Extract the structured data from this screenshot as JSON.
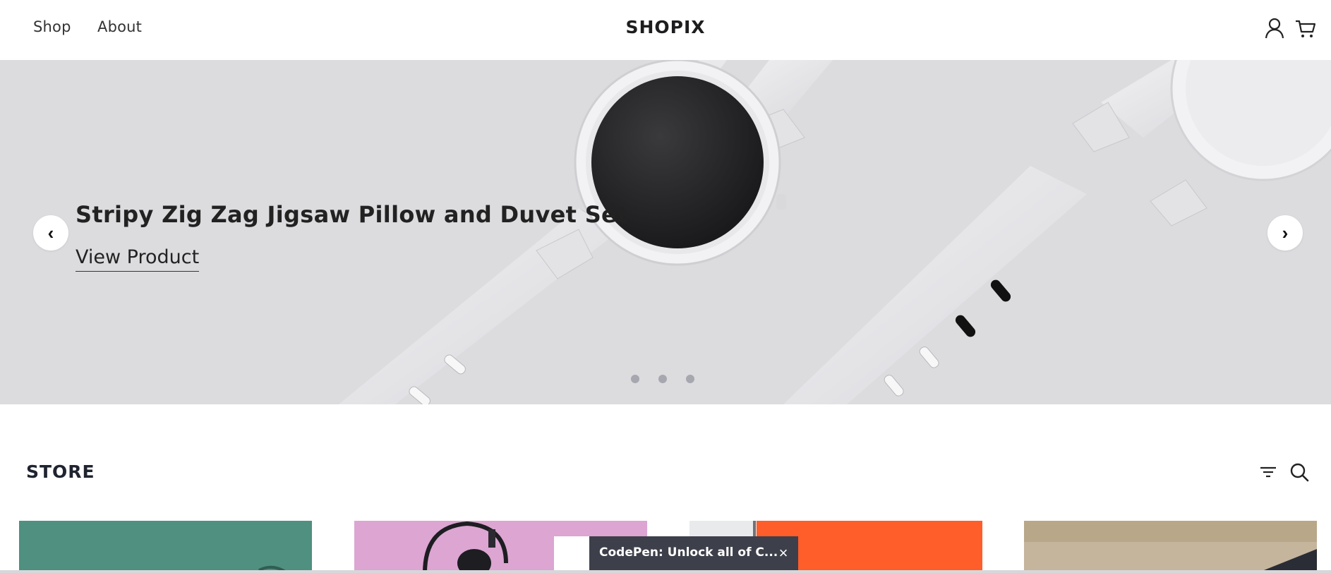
{
  "header": {
    "nav": [
      "Shop",
      "About"
    ],
    "brand": "SHOPIX",
    "icons": [
      "user-icon",
      "cart-icon"
    ]
  },
  "hero": {
    "title": "Stripy Zig Zag Jigsaw Pillow and Duvet Set",
    "cta": "View Product",
    "prev_glyph": "‹",
    "next_glyph": "›",
    "slide_count": 3,
    "image": "white smartwatch on grey background"
  },
  "store": {
    "title": "STORE",
    "icons": [
      "filter-icon",
      "search-icon"
    ],
    "product_cards": [
      {
        "image": "teal product",
        "color": "#4f9080"
      },
      {
        "image": "headphones on pink",
        "color": "#dca5d2"
      },
      {
        "image": "orange product",
        "color": "#ff5d2a"
      },
      {
        "image": "beige product",
        "color": "#c5b59c"
      }
    ]
  },
  "toast": {
    "text": "CodePen: Unlock all of C...",
    "close": "×"
  },
  "colors": {
    "hero_bg": "#dcdcdf",
    "text_dark": "#222222",
    "toast_bg": "#3d3f4a"
  }
}
